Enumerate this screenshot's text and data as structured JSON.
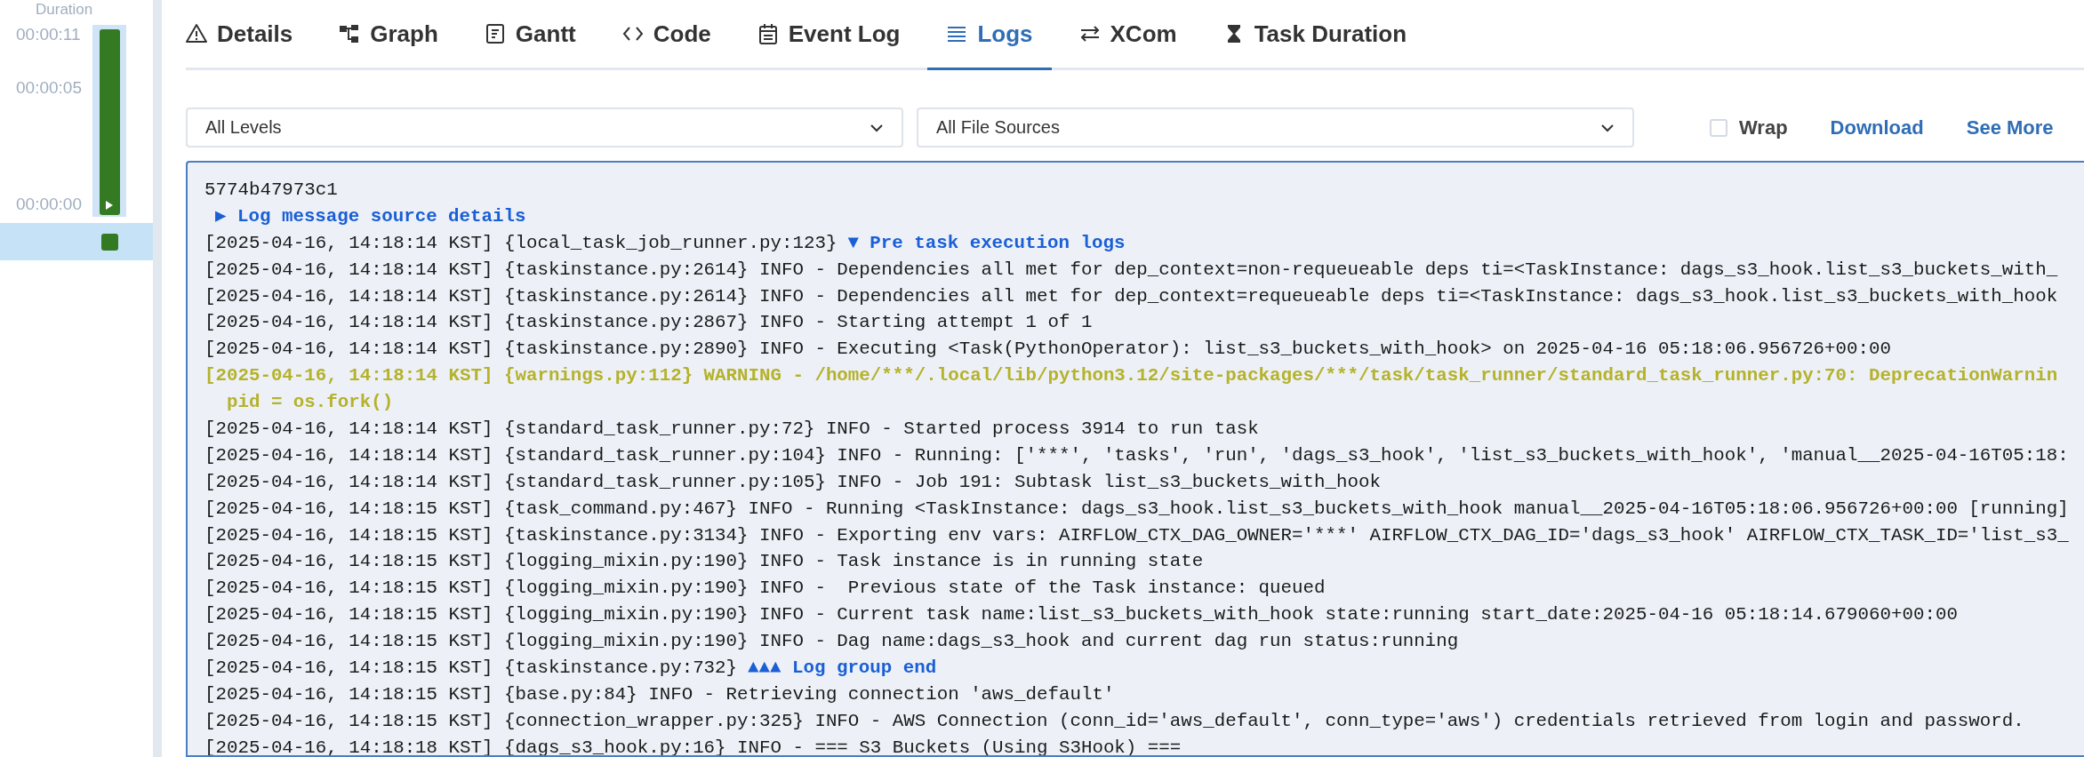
{
  "sidebar": {
    "axis_title": "Duration",
    "ticks": [
      "00:00:11",
      "00:00:05",
      "00:00:00"
    ],
    "task_row": {
      "selected": true
    }
  },
  "tabs": [
    {
      "label": "Details",
      "kind": "details",
      "selected": false
    },
    {
      "label": "Graph",
      "kind": "graph",
      "selected": false
    },
    {
      "label": "Gantt",
      "kind": "gantt",
      "selected": false
    },
    {
      "label": "Code",
      "kind": "code",
      "selected": false
    },
    {
      "label": "Event Log",
      "kind": "events",
      "selected": false
    },
    {
      "label": "Logs",
      "kind": "logs",
      "selected": true
    },
    {
      "label": "XCom",
      "kind": "xcom",
      "selected": false
    },
    {
      "label": "Task Duration",
      "kind": "duration",
      "selected": false
    }
  ],
  "filters": [
    {
      "value": "All Levels"
    },
    {
      "value": "All File Sources"
    }
  ],
  "wrap": {
    "label": "Wrap",
    "checked": false
  },
  "links": [
    "Download",
    "See More"
  ],
  "log": {
    "lines": [
      {
        "kind": "plain",
        "text": "5774b47973c1"
      },
      {
        "kind": "toggle",
        "text": "▶ Log message source details"
      },
      {
        "kind": "group",
        "text": "[2025-04-16, 14:18:14 KST] {local_task_job_runner.py:123}",
        "marker": "▼ Pre task execution logs"
      },
      {
        "kind": "plain",
        "text": "[2025-04-16, 14:18:14 KST] {taskinstance.py:2614} INFO - Dependencies all met for dep_context=non-requeueable deps ti=<TaskInstance: dags_s3_hook.list_s3_buckets_with_"
      },
      {
        "kind": "plain",
        "text": "[2025-04-16, 14:18:14 KST] {taskinstance.py:2614} INFO - Dependencies all met for dep_context=requeueable deps ti=<TaskInstance: dags_s3_hook.list_s3_buckets_with_hook"
      },
      {
        "kind": "plain",
        "text": "[2025-04-16, 14:18:14 KST] {taskinstance.py:2867} INFO - Starting attempt 1 of 1"
      },
      {
        "kind": "plain",
        "text": "[2025-04-16, 14:18:14 KST] {taskinstance.py:2890} INFO - Executing <Task(PythonOperator): list_s3_buckets_with_hook> on 2025-04-16 05:18:06.956726+00:00"
      },
      {
        "kind": "warning",
        "text": "[2025-04-16, 14:18:14 KST] {warnings.py:112} WARNING - /home/***/.local/lib/python3.12/site-packages/***/task/task_runner/standard_task_runner.py:70: DeprecationWarnin"
      },
      {
        "kind": "warning",
        "text": "  pid = os.fork()"
      },
      {
        "kind": "plain",
        "text": "[2025-04-16, 14:18:14 KST] {standard_task_runner.py:72} INFO - Started process 3914 to run task"
      },
      {
        "kind": "plain",
        "text": "[2025-04-16, 14:18:14 KST] {standard_task_runner.py:104} INFO - Running: ['***', 'tasks', 'run', 'dags_s3_hook', 'list_s3_buckets_with_hook', 'manual__2025-04-16T05:18:"
      },
      {
        "kind": "plain",
        "text": "[2025-04-16, 14:18:14 KST] {standard_task_runner.py:105} INFO - Job 191: Subtask list_s3_buckets_with_hook"
      },
      {
        "kind": "plain",
        "text": "[2025-04-16, 14:18:15 KST] {task_command.py:467} INFO - Running <TaskInstance: dags_s3_hook.list_s3_buckets_with_hook manual__2025-04-16T05:18:06.956726+00:00 [running]"
      },
      {
        "kind": "plain",
        "text": "[2025-04-16, 14:18:15 KST] {taskinstance.py:3134} INFO - Exporting env vars: AIRFLOW_CTX_DAG_OWNER='***' AIRFLOW_CTX_DAG_ID='dags_s3_hook' AIRFLOW_CTX_TASK_ID='list_s3_"
      },
      {
        "kind": "plain",
        "text": "[2025-04-16, 14:18:15 KST] {logging_mixin.py:190} INFO - Task instance is in running state"
      },
      {
        "kind": "plain",
        "text": "[2025-04-16, 14:18:15 KST] {logging_mixin.py:190} INFO -  Previous state of the Task instance: queued"
      },
      {
        "kind": "plain",
        "text": "[2025-04-16, 14:18:15 KST] {logging_mixin.py:190} INFO - Current task name:list_s3_buckets_with_hook state:running start_date:2025-04-16 05:18:14.679060+00:00"
      },
      {
        "kind": "plain",
        "text": "[2025-04-16, 14:18:15 KST] {logging_mixin.py:190} INFO - Dag name:dags_s3_hook and current dag run status:running"
      },
      {
        "kind": "group",
        "text": "[2025-04-16, 14:18:15 KST] {taskinstance.py:732}",
        "marker": "▲▲▲ Log group end"
      },
      {
        "kind": "plain",
        "text": "[2025-04-16, 14:18:15 KST] {base.py:84} INFO - Retrieving connection 'aws_default'"
      },
      {
        "kind": "plain",
        "text": "[2025-04-16, 14:18:15 KST] {connection_wrapper.py:325} INFO - AWS Connection (conn_id='aws_default', conn_type='aws') credentials retrieved from login and password."
      },
      {
        "kind": "plain",
        "text": "[2025-04-16, 14:18:18 KST] {dags_s3_hook.py:16} INFO - === S3 Buckets (Using S3Hook) ==="
      }
    ]
  }
}
